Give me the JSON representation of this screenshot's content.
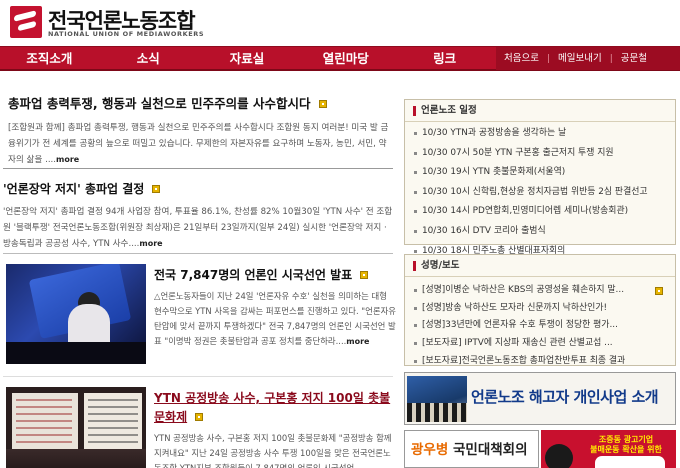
{
  "header": {
    "logo_title": "전국언론노동조합",
    "logo_subtitle": "NATIONAL UNION OF MEDIAWORKERS"
  },
  "nav": {
    "main": [
      {
        "label": "조직소개"
      },
      {
        "label": "소식"
      },
      {
        "label": "자료실"
      },
      {
        "label": "열린마당"
      },
      {
        "label": "링크"
      }
    ],
    "utility": [
      {
        "label": "처음으로"
      },
      {
        "label": "메일보내기"
      },
      {
        "label": "공문철"
      }
    ]
  },
  "articles": {
    "top": {
      "title": "총파업 총력투쟁, 행동과 실천으로 민주주의를 사수합시다",
      "body": "[조합원과 함께] 총파업 총력투쟁, 행동과 실천으로 민주주의를 사수합시다 조합원 동지 여러분! 미국 발 금융위기가 전 세계를 공황의 늪으로 떠밀고 있습니다. 무제한의 자본자유를 요구하며 노동자, 농민, 서민, 약자의 삶을 ....",
      "more": "more"
    },
    "second": {
      "title": "'언론장악 저지' 총파업 결정",
      "body": "'언론장악 저지' 총파업 결정 94개 사업장 참여, 투표율 86.1%, 찬성률 82% 10월30일 'YTN 사수' 전 조합원 '블랙투쟁' 전국언론노동조합(위원장 최상재)은 21일부터 23일까지(일부 24일) 실시한 '언론장악 저지 · 방송독립과 공공성 사수, YTN 사수....",
      "more": "more"
    },
    "feature1": {
      "title": "전국 7,847명의 언론인 시국선언 발표",
      "body": "△언론노동자들이 지난 24일 '언론자유 수호' 실천을 의미하는 대형 현수막으로 YTN 사옥을 감싸는 퍼포먼스를 진행하고 있다. \"언론자유 탄압에 맞서 끝까지 투쟁하겠다\" 전국 7,847명의 언론인 시국선언 발표 \"이명박 정권은 촛불탄압과 공포 정치를 중단하라....",
      "more": "more"
    },
    "feature2": {
      "title": "YTN 공정방송 사수, 구본홍 저지 100일 촛불문화제",
      "body": "YTN 공정방송 사수, 구본홍 저지 100일 촛불문화제 \"공정방송 함께 지켜내요\" 지난 24일 공정방송 사수 투쟁 100일을 맞은 전국언론노동조합 YTN지부 조합원들이 7,847명의 언론인 시국선언"
    }
  },
  "schedule": {
    "title": "언론노조 일정",
    "items": [
      "10/30 YTN과 공정방송을 생각하는 날",
      "10/30 07시 50분 YTN 구본홍 출근저지 투쟁 지원",
      "10/30 19시 YTN 촛불문화제(서울역)",
      "10/30 10시 신학림,현상윤 정치자금법 위반등 2심 판결선고",
      "10/30 14시 PD연합회,민영미디어렙 세미나(방송회관)",
      "10/30 16시 DTV 코리아 출범식",
      "10/30 18시 민주노총 산별대표자회의"
    ]
  },
  "press": {
    "title": "성명/보도",
    "items": [
      "[성명]이병순 낙하산은 KBS의 공영성을 훼손하지 말...",
      "[성명]방송 낙하산도 모자라 신문까지 낙하산인가!",
      "[성명]33년만에 언론자유 수호 투쟁이 정당한 평가...",
      "[보도자료] IPTV에 지상파 재송신 관련 산별교섭 ...",
      "[보도자료]전국언론노동조합 총파업찬반투표 최종 결과"
    ]
  },
  "banners": {
    "dismissed": "언론노조 해고자 개인사업 소개",
    "name_part1": "광우병",
    "name_part2": "국민대책회의",
    "ad_line1": "조중동 광고기업",
    "ad_line2": "불매운동 확산을 위한"
  },
  "colors": {
    "brand_red": "#b8102a",
    "utility_red": "#9c0c22",
    "banner_blue": "#123a8a",
    "badge_yellow": "#e6b400"
  }
}
